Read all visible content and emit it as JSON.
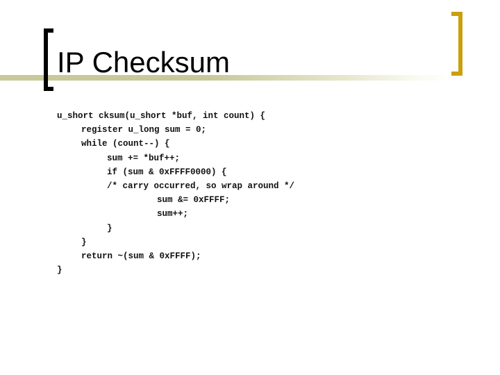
{
  "slide": {
    "title": "IP Checksum",
    "accent_colors": {
      "left_bracket": "#000000",
      "right_bracket": "#c9a00e",
      "title_rule": "#c8c89a"
    },
    "code": {
      "language": "C",
      "lines": [
        {
          "indent": 0,
          "text": "u_short cksum(u_short *buf, int count) {"
        },
        {
          "indent": 1,
          "text": "register u_long sum = 0;"
        },
        {
          "indent": 1,
          "text": "while (count--) {"
        },
        {
          "indent": 2,
          "text": "sum += *buf++;"
        },
        {
          "indent": 2,
          "text": "if (sum & 0xFFFF0000) {"
        },
        {
          "indent": 2,
          "text": "/* carry occurred, so wrap around */"
        },
        {
          "indent": 3,
          "text": "sum &= 0xFFFF;"
        },
        {
          "indent": 3,
          "text": "sum++;"
        },
        {
          "indent": 2,
          "text": "}"
        },
        {
          "indent": 1,
          "text": "}"
        },
        {
          "indent": 1,
          "text": "return ~(sum & 0xFFFF);"
        },
        {
          "indent": 0,
          "text": "}"
        }
      ]
    }
  }
}
